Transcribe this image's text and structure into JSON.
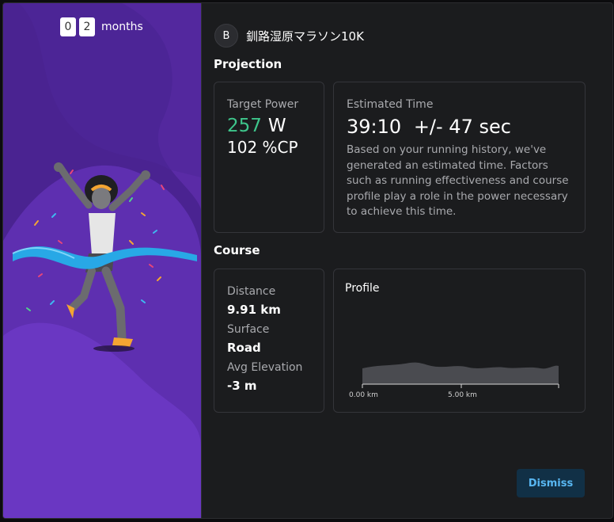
{
  "countdown": {
    "digits": [
      "0",
      "2"
    ],
    "unit_label": "months"
  },
  "race": {
    "badge": "B",
    "name": "釧路湿原マラソン10K"
  },
  "projection": {
    "title": "Projection",
    "target_power": {
      "label": "Target Power",
      "value": "257",
      "unit": "W",
      "cp": "102 %CP"
    },
    "estimated_time": {
      "label": "Estimated Time",
      "time": "39:10",
      "margin": "+/- 47 sec",
      "description": "Based on your running history, we've generated an estimated time. Factors such as running effectiveness and course profile play a role in the power necessary to achieve this time."
    }
  },
  "course": {
    "title": "Course",
    "distance": {
      "label": "Distance",
      "value": "9.91 km"
    },
    "surface": {
      "label": "Surface",
      "value": "Road"
    },
    "avg_elevation": {
      "label": "Avg Elevation",
      "value": "-3 m"
    },
    "profile": {
      "title": "Profile",
      "x_ticks": [
        "0.00 km",
        "5.00 km"
      ],
      "total_km": 9.91
    }
  },
  "actions": {
    "dismiss_label": "Dismiss"
  },
  "colors": {
    "accent_green": "#3ec58b",
    "accent_purple": "#4a2391",
    "dismiss_text": "#58b7f2"
  }
}
